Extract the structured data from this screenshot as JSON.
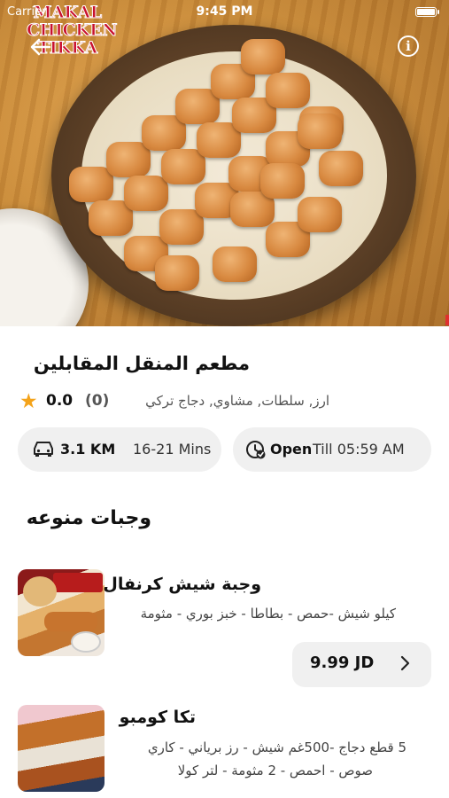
{
  "status_bar": {
    "carrier": "Carrier",
    "time": "9:45 PM"
  },
  "hero": {
    "logo_lines": [
      "MAKAL",
      "CHICKEN",
      "TIKKA"
    ],
    "back_icon": "arrow-left-icon",
    "info_icon": "info-icon",
    "info_glyph": "i"
  },
  "restaurant": {
    "name": "مطعم المنقل المقابلين",
    "rating": "0.0",
    "rating_count": "(0)",
    "cuisines": "ارز, سلطات, مشاوي, دجاج تركي",
    "distance": "3.1 KM",
    "delivery_time": "16-21 Mins",
    "status": "Open",
    "hours": "Till 05:59 AM"
  },
  "section": {
    "title": "وجبات منوعه"
  },
  "menu_items": [
    {
      "name": "وجبة شيش كرنفال",
      "description": "كيلو شيش -حمص - بطاطا - خبز بوري - مثومة",
      "price": "9.99 JD"
    },
    {
      "name": "تكا كومبو",
      "description_line1": "5 قطع دجاج -500غم شيش - رز برياني - كاري",
      "description_line2": "صوص - احمص - 2 مثومة - لتر كولا"
    }
  ],
  "colors": {
    "star": "#f4a31a",
    "chip_bg": "#f0f0f0",
    "logo_red": "#c8102e"
  }
}
